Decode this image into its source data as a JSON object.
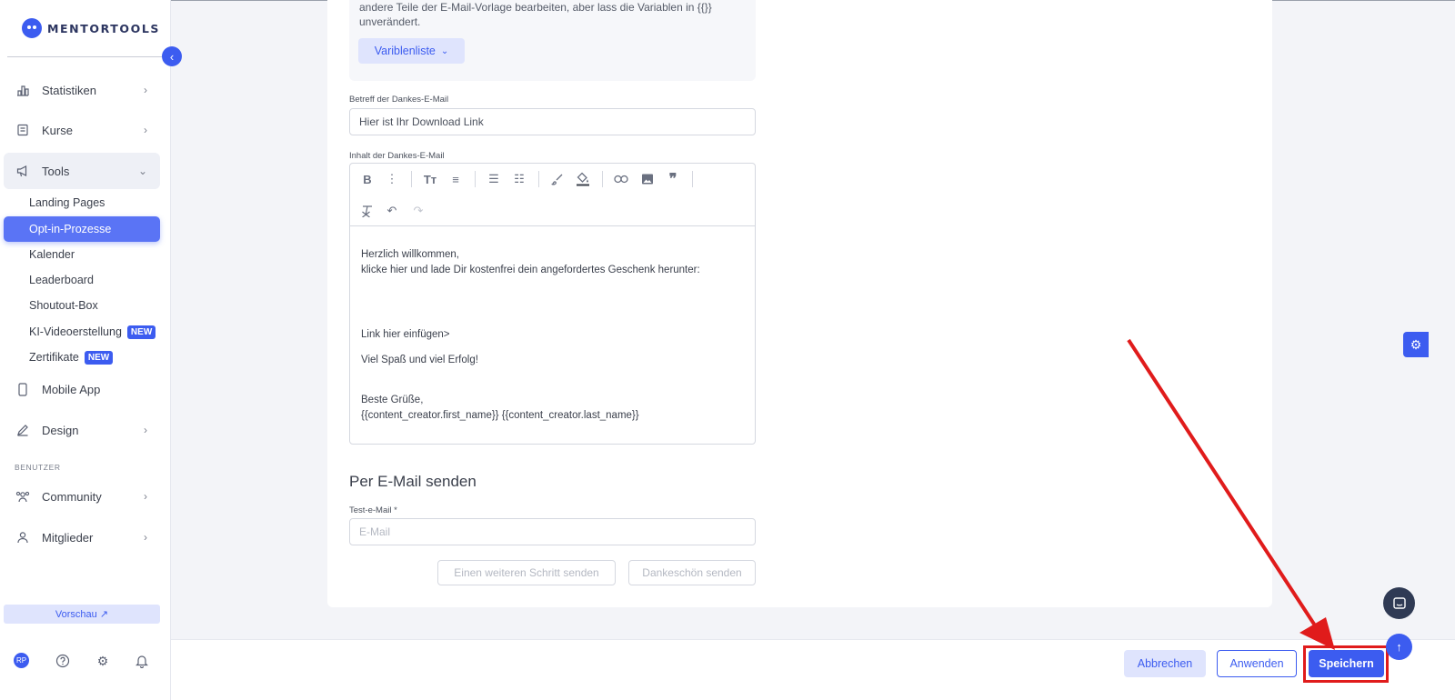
{
  "brand": {
    "name": "MENTORTOOLS"
  },
  "sidebar": {
    "items": [
      {
        "label": "Statistiken",
        "icon": "bar-chart-icon"
      },
      {
        "label": "Kurse",
        "icon": "book-icon"
      },
      {
        "label": "Tools",
        "icon": "megaphone-icon"
      },
      {
        "label": "Mobile App",
        "icon": "mobile-icon"
      },
      {
        "label": "Design",
        "icon": "pencil-icon"
      },
      {
        "label": "Community",
        "icon": "community-icon"
      },
      {
        "label": "Mitglieder",
        "icon": "user-icon"
      }
    ],
    "tools_sub": [
      {
        "label": "Landing Pages"
      },
      {
        "label": "Opt-in-Prozesse"
      },
      {
        "label": "Kalender"
      },
      {
        "label": "Leaderboard"
      },
      {
        "label": "Shoutout-Box"
      },
      {
        "label": "KI-Videoerstellung",
        "badge": "NEW"
      },
      {
        "label": "Zertifikate",
        "badge": "NEW"
      }
    ],
    "section_user": "BENUTZER",
    "preview_label": "Vorschau ↗",
    "avatar_initials": "RP"
  },
  "form": {
    "hint_text": "andere Teile der E-Mail-Vorlage bearbeiten, aber lass die Variablen in {{}} unverändert.",
    "variables_button": "Variblenliste",
    "subject_label": "Betreff der Dankes-E-Mail",
    "subject_value": "Hier ist Ihr Download Link",
    "content_label": "Inhalt der Dankes-E-Mail",
    "editor_lines": {
      "l1": "Herzlich willkommen,",
      "l2": "klicke hier und lade Dir kostenfrei dein angefordertes Geschenk herunter:",
      "l3": "Link hier einfügen>",
      "l4": "Viel Spaß und viel Erfolg!",
      "l5": "Beste Grüße,",
      "l6": "{{content_creator.first_name}} {{content_creator.last_name}}"
    },
    "send_heading": "Per E-Mail senden",
    "test_email_label": "Test-e-Mail *",
    "test_email_placeholder": "E-Mail",
    "send_step_button": "Einen weiteren Schritt senden",
    "send_thanks_button": "Dankeschön senden"
  },
  "footer": {
    "cancel": "Abbrechen",
    "apply": "Anwenden",
    "save": "Speichern"
  },
  "colors": {
    "accent": "#3c5cf0",
    "annotation": "#e01b1b"
  }
}
